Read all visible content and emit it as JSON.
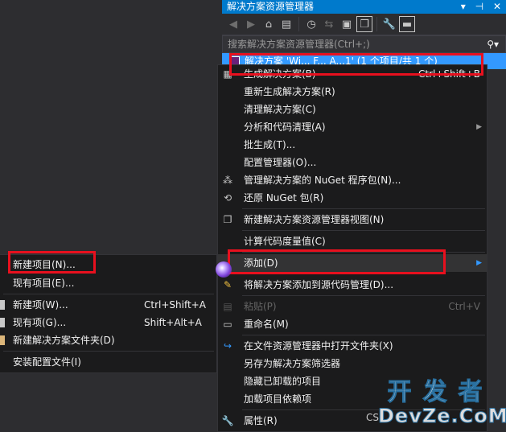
{
  "solution_explorer": {
    "title": "解决方案资源管理器",
    "search_placeholder": "搜索解决方案资源管理器(Ctrl+;)",
    "tree_root_label": "解决方案 'Wi... F... A...1' (1 个项目/共 1 个)",
    "toolbar_icons": [
      "back-icon",
      "forward-icon",
      "home-icon",
      "solution-switch-icon",
      "history-icon",
      "sync-icon",
      "collapse-all-icon",
      "show-all-files-icon",
      "properties-icon",
      "preview-icon"
    ]
  },
  "context_menu": {
    "items": [
      {
        "label": "生成解决方案(B)",
        "shortcut": "Ctrl+Shift+B",
        "icon": "build-icon"
      },
      {
        "label": "重新生成解决方案(R)",
        "shortcut": "",
        "icon": ""
      },
      {
        "label": "清理解决方案(C)",
        "shortcut": "",
        "icon": ""
      },
      {
        "label": "分析和代码清理(A)",
        "shortcut": "",
        "icon": "",
        "submenu": true
      },
      {
        "label": "批生成(T)...",
        "shortcut": "",
        "icon": ""
      },
      {
        "label": "配置管理器(O)...",
        "shortcut": "",
        "icon": ""
      },
      {
        "label": "管理解决方案的 NuGet 程序包(N)...",
        "shortcut": "",
        "icon": "nuget-icon"
      },
      {
        "label": "还原 NuGet 包(R)",
        "shortcut": "",
        "icon": "restore-icon"
      },
      {
        "label": "新建解决方案资源管理器视图(N)",
        "shortcut": "",
        "icon": "new-view-icon"
      },
      {
        "label": "计算代码度量值(C)",
        "shortcut": "",
        "icon": ""
      },
      {
        "label": "添加(D)",
        "shortcut": "",
        "icon": "",
        "submenu": true
      },
      {
        "label": "将解决方案添加到源代码管理(D)...",
        "shortcut": "",
        "icon": "source-control-icon"
      },
      {
        "label": "粘贴(P)",
        "shortcut": "Ctrl+V",
        "icon": "paste-icon",
        "disabled": true
      },
      {
        "label": "重命名(M)",
        "shortcut": "",
        "icon": "rename-icon"
      },
      {
        "label": "在文件资源管理器中打开文件夹(X)",
        "shortcut": "",
        "icon": "open-folder-icon"
      },
      {
        "label": "另存为解决方案筛选器",
        "shortcut": "",
        "icon": ""
      },
      {
        "label": "隐藏已卸载的项目",
        "shortcut": "",
        "icon": ""
      },
      {
        "label": "加载项目依赖项",
        "shortcut": "",
        "icon": ""
      },
      {
        "label": "属性(R)",
        "shortcut": "",
        "icon": "wrench-icon"
      }
    ]
  },
  "add_submenu": {
    "items": [
      {
        "label": "新建项目(N)...",
        "shortcut": ""
      },
      {
        "label": "现有项目(E)...",
        "shortcut": ""
      },
      {
        "label": "新建项(W)...",
        "shortcut": "Ctrl+Shift+A"
      },
      {
        "label": "现有项(G)...",
        "shortcut": "Shift+Alt+A"
      },
      {
        "label": "新建解决方案文件夹(D)",
        "shortcut": ""
      },
      {
        "label": "安装配置文件(I)",
        "shortcut": ""
      }
    ]
  },
  "background_text": "CS",
  "watermark": {
    "top": "开发者",
    "bottom": "DevZe.CoM"
  },
  "colors": {
    "accent": "#007acc",
    "highlight": "#e8101e",
    "menu_bg": "#1b1b1c",
    "selected": "#3399ff"
  }
}
